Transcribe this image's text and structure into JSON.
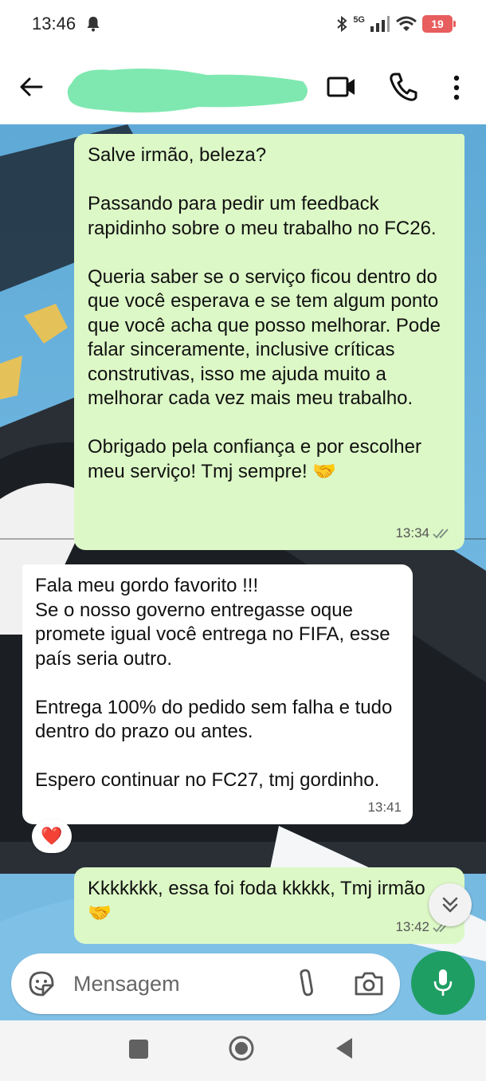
{
  "status_bar": {
    "time": "13:46",
    "network": "5G",
    "battery": "19"
  },
  "header": {
    "contact_name_redacted": true
  },
  "messages": [
    {
      "direction": "outgoing",
      "text": "Salve irmão, beleza?\n\nPassando para pedir um feedback rapidinho sobre o meu trabalho no FC26.\n\nQueria saber se o serviço ficou dentro do que você esperava e se tem algum ponto que você acha que posso melhorar. Pode falar sinceramente, inclusive críticas construtivas, isso me ajuda muito a melhorar cada vez mais meu trabalho.\n\nObrigado pela confiança e por escolher meu serviço! Tmj sempre! 🤝",
      "time": "13:34",
      "status": "read"
    },
    {
      "direction": "incoming",
      "text": "Fala meu gordo favorito !!!\nSe o nosso governo entregasse oque promete igual você entrega no FIFA, esse país seria outro.\n\nEntrega 100% do pedido sem falha e tudo dentro do prazo ou antes.\n\nEspero continuar no FC27, tmj gordinho.",
      "time": "13:41",
      "reaction": "❤️"
    },
    {
      "direction": "outgoing",
      "text": "Kkkkkkk, essa foi foda kkkkk, Tmj irmão 🤝",
      "time": "13:42",
      "status": "read"
    }
  ],
  "composer": {
    "placeholder": "Mensagem"
  },
  "colors": {
    "outgoing_bubble": "#dcf8c6",
    "incoming_bubble": "#ffffff",
    "mic_button": "#1f9e63",
    "battery": "#e85d5d"
  },
  "icons": {
    "back": "arrow-left-icon",
    "video": "video-camera-icon",
    "call": "phone-icon",
    "more": "more-vertical-icon",
    "sticker": "sticker-icon",
    "attach": "paperclip-icon",
    "camera": "camera-icon",
    "mic": "microphone-icon",
    "scroll": "double-chevron-down-icon"
  }
}
